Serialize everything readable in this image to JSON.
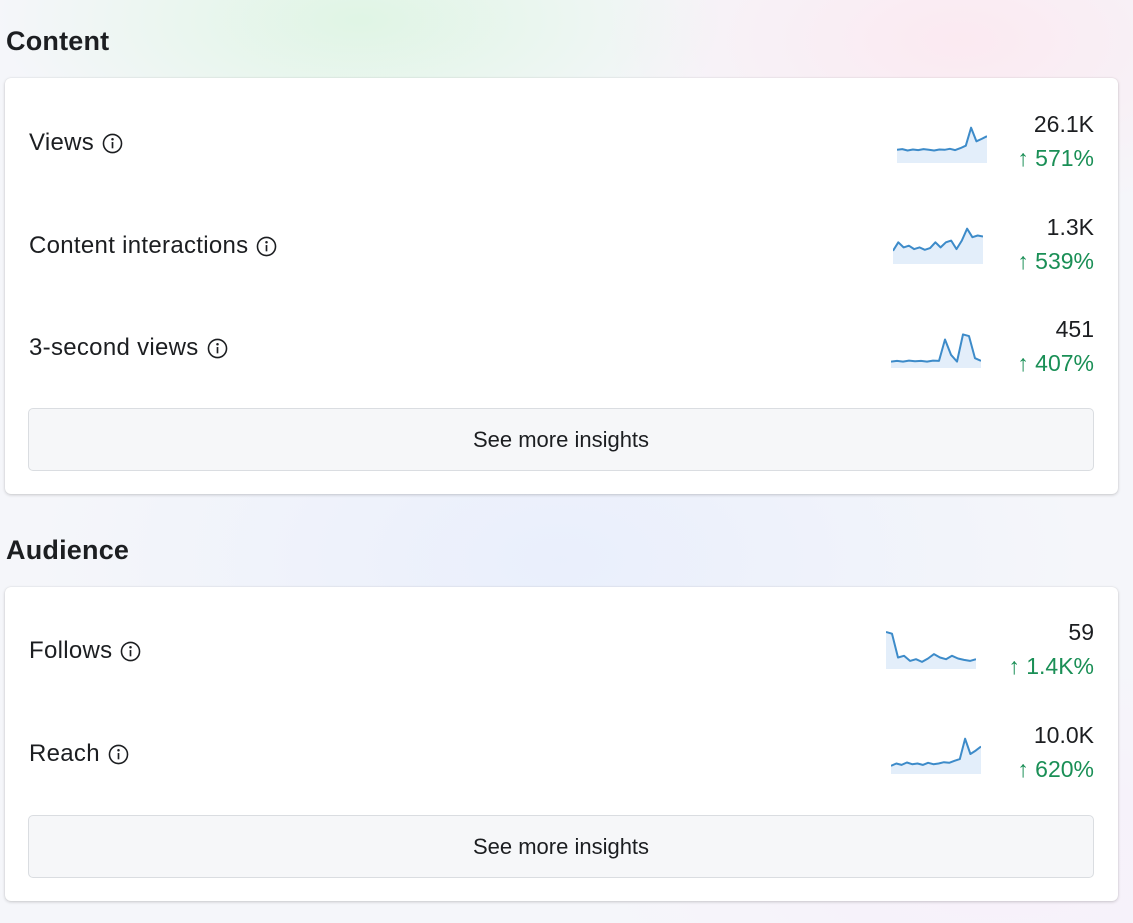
{
  "content": {
    "title": "Content",
    "metrics": [
      {
        "label": "Views",
        "value": "26.1K",
        "change": "↑ 571%",
        "trend": [
          0.3,
          0.32,
          0.28,
          0.31,
          0.29,
          0.32,
          0.3,
          0.28,
          0.31,
          0.3,
          0.33,
          0.29,
          0.35,
          0.42,
          0.95,
          0.55,
          0.62,
          0.7
        ]
      },
      {
        "label": "Content interactions",
        "value": "1.3K",
        "change": "↑ 539%",
        "trend": [
          0.3,
          0.55,
          0.4,
          0.45,
          0.35,
          0.4,
          0.33,
          0.38,
          0.55,
          0.4,
          0.55,
          0.6,
          0.35,
          0.6,
          0.95,
          0.7,
          0.75,
          0.72
        ]
      },
      {
        "label": "3-second views",
        "value": "451",
        "change": "↑ 407%",
        "trend": [
          0.1,
          0.12,
          0.1,
          0.13,
          0.11,
          0.12,
          0.1,
          0.13,
          0.12,
          0.75,
          0.3,
          0.1,
          0.9,
          0.85,
          0.2,
          0.12
        ]
      }
    ],
    "see_more_label": "See more insights"
  },
  "audience": {
    "title": "Audience",
    "metrics": [
      {
        "label": "Follows",
        "value": "59",
        "change": "↑ 1.4K%",
        "trend": [
          1.0,
          0.95,
          0.25,
          0.3,
          0.15,
          0.2,
          0.12,
          0.22,
          0.35,
          0.25,
          0.2,
          0.3,
          0.22,
          0.18,
          0.15,
          0.2
        ]
      },
      {
        "label": "Reach",
        "value": "10.0K",
        "change": "↑ 620%",
        "trend": [
          0.15,
          0.22,
          0.18,
          0.25,
          0.2,
          0.22,
          0.18,
          0.24,
          0.2,
          0.22,
          0.26,
          0.24,
          0.3,
          0.35,
          0.95,
          0.5,
          0.6,
          0.72
        ]
      }
    ],
    "see_more_label": "See more insights"
  },
  "colors": {
    "sparkline_stroke": "#3d8bc9",
    "sparkline_fill": "#e3eefa",
    "positive_change": "#1a8f56"
  }
}
